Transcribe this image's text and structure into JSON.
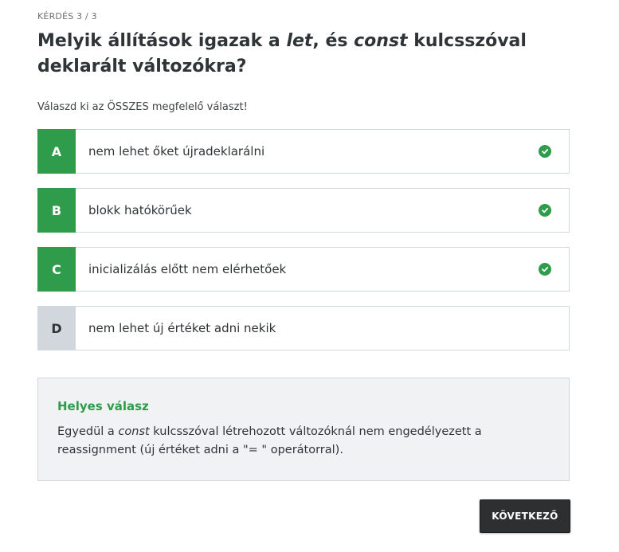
{
  "counter": "KÉRDÉS 3 / 3",
  "question": {
    "part1": "Melyik állítások igazak a ",
    "kw1": "let",
    "part2": ", és ",
    "kw2": "const",
    "part3": " kulcsszóval deklarált változókra?"
  },
  "instruction": "Válaszd ki az ÖSSZES megfelelő választ!",
  "answers": [
    {
      "letter": "A",
      "text": "nem lehet őket újradeklarálni",
      "correct": true
    },
    {
      "letter": "B",
      "text": "blokk hatókörűek",
      "correct": true
    },
    {
      "letter": "C",
      "text": "inicializálás előtt nem elérhetőek",
      "correct": true
    },
    {
      "letter": "D",
      "text": "nem lehet új értéket adni nekik",
      "correct": false
    }
  ],
  "feedback": {
    "title": "Helyes válasz",
    "text_before": "Egyedül a ",
    "keyword": "const",
    "text_after": " kulcsszóval létrehozott változóknál nem engedélyezett a reassignment (új értéket adni a \"= \" operátorral)."
  },
  "next_button": "KÖVETKEZŐ",
  "colors": {
    "correct": "#2e9c4a",
    "neutral": "#d1d7dc",
    "button": "#2d2f31"
  },
  "icons": {
    "correct_marker": "check-circle-icon"
  }
}
